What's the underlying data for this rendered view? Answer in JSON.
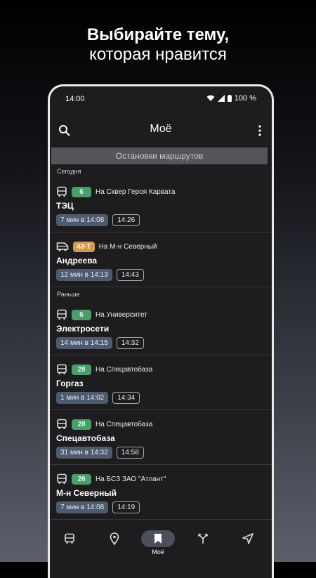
{
  "headline": {
    "line1": "Выбирайте тему,",
    "line2": "которая нравится"
  },
  "status": {
    "time": "14:00",
    "battery": "100 %"
  },
  "appbar": {
    "title": "Моё"
  },
  "section_header": "Остановки маршрутов",
  "groups": {
    "today": "Сегодня",
    "earlier": "Раньше"
  },
  "items": [
    {
      "route": "6",
      "direction": "На Сквер Героя Карвата",
      "stop": "ТЭЦ",
      "wait": "7 мин в 14:08",
      "time": "14:26",
      "vehicle": "bus"
    },
    {
      "route": "43-Т",
      "direction": "На М-н Северный",
      "stop": "Андреева",
      "wait": "12 мин в 14:13",
      "time": "14:43",
      "vehicle": "minibus"
    },
    {
      "route": "6",
      "direction": "На Университет",
      "stop": "Электросети",
      "wait": "14 мин в 14:15",
      "time": "14:32",
      "vehicle": "bus"
    },
    {
      "route": "28",
      "direction": "На Спецавтобаза",
      "stop": "Горгаз",
      "wait": "1 мин в 14:02",
      "time": "14:34",
      "vehicle": "bus"
    },
    {
      "route": "28",
      "direction": "На Спецавтобаза",
      "stop": "Спецавтобаза",
      "wait": "31 мин в 14:32",
      "time": "14:58",
      "vehicle": "bus"
    },
    {
      "route": "26",
      "direction": "На БСЗ ЗАО \"Атлант\"",
      "stop": "М-н Северный",
      "wait": "7 мин в 14:08",
      "time": "14:19",
      "vehicle": "bus"
    }
  ],
  "nav": {
    "active_label": "Моё"
  },
  "colors": {
    "green_badge": "#4a9e6a",
    "orange_badge": "#d39a4d",
    "wait_chip": "#4e5b6e",
    "panel": "#1d1d1f"
  }
}
